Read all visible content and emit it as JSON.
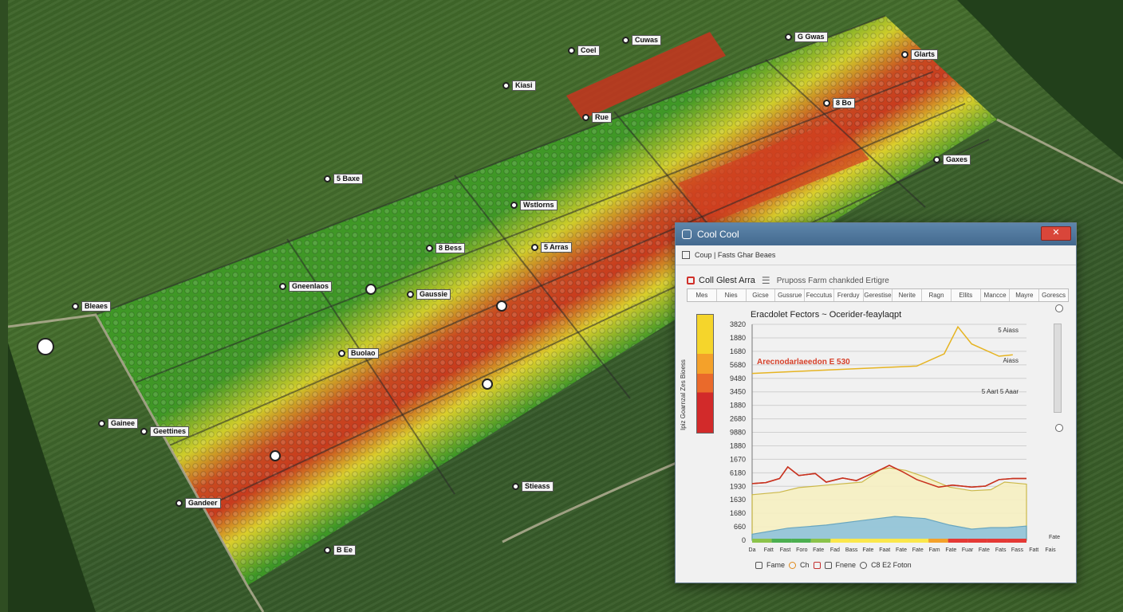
{
  "map": {
    "labels": [
      "Cuwas",
      "Coel",
      "Kiasi",
      "G Gwas",
      "Glarts",
      "Rue",
      "8 Bo",
      "Gaxes",
      "5 Baxe",
      "Wstlorns",
      "8 Bess",
      "5 Arras",
      "Gneenlaos",
      "Gaussie",
      "Buolao",
      "Bleaes",
      "Gainee",
      "Geettines",
      "Gandeer",
      "B Ee",
      "Stieass"
    ]
  },
  "window": {
    "title": "Cool Cool",
    "close_glyph": "✕",
    "menu": "Coup | Fasts Ghar Beaes",
    "section_title": "Coll Glest Arra",
    "section_menu_glyph": "☰",
    "section_subtitle": "Pruposs Farm chankded Ertigre",
    "tabs": [
      "Mes",
      "Nies",
      "Gicse",
      "Gussrue",
      "Feccutus",
      "Frerduy",
      "Gerestise",
      "Nerite",
      "Ragn",
      "Ellits",
      "Mancce",
      "Mayre",
      "Gorescs"
    ],
    "legend_label": "Ipiz Goarnzal Zes Bioess",
    "chart_title": "Eracdolet Fectors ~ Ocerider-feaylaqpt",
    "overlay_label": "Arecnodarlaeedon  E 530",
    "status": [
      "Fame",
      "Ch",
      "Fnene",
      "C8 E2 Foton"
    ]
  },
  "chart_data": [
    {
      "type": "line",
      "title": "Eracdolet Fectors ~ Ocerider-feaylaqpt",
      "y_ticks": [
        "3820",
        "1880",
        "1680",
        "5680",
        "9480",
        "3450",
        "1880",
        "2680",
        "9880",
        "1880",
        "1670",
        "6180",
        "1930",
        "1630",
        "1680",
        "660",
        "0"
      ],
      "annotations": [
        "Arecnodarlaeedon  E 530",
        "5 Aiass",
        "Aiass",
        "5 Aart 5 Aaar"
      ],
      "x_tick_labels": [
        "Da",
        "Fatt",
        "Fast",
        "Foro",
        "Fate",
        "Fad",
        "Bass",
        "Fate",
        "Faat",
        "Fate",
        "Fate",
        "Fam",
        "Fate",
        "Fuar",
        "Fate",
        "Fats",
        "Fass",
        "Fatt",
        "Fais"
      ],
      "x_end_label": "Fate",
      "x_band_colors": [
        "#8bc34a",
        "#4caf50",
        "#4caf50",
        "#8bc34a",
        "#fbe74b",
        "#fbe74b",
        "#fbe74b",
        "#fbe74b",
        "#fbe74b",
        "#f4a12a",
        "#e53935",
        "#e53935",
        "#e53935",
        "#e53935"
      ],
      "series": [
        {
          "style": "line",
          "color": "#e6b422",
          "x": [
            0,
            0.2,
            0.4,
            0.6,
            0.7,
            0.75,
            0.8,
            0.9,
            0.95
          ],
          "y": [
            2900,
            2950,
            3000,
            3050,
            3300,
            3850,
            3500,
            3250,
            3280
          ]
        },
        {
          "style": "line",
          "color": "#c8321f",
          "x": [
            0,
            0.05,
            0.1,
            0.13,
            0.17,
            0.23,
            0.27,
            0.33,
            0.38,
            0.47,
            0.5,
            0.55,
            0.6,
            0.68,
            0.73,
            0.8,
            0.85,
            0.9,
            0.95,
            1
          ],
          "y": [
            1120,
            1140,
            1220,
            1450,
            1280,
            1320,
            1150,
            1230,
            1180,
            1400,
            1480,
            1350,
            1200,
            1050,
            1090,
            1050,
            1070,
            1200,
            1220,
            1220
          ]
        },
        {
          "style": "area",
          "color": "#f7f0c2",
          "stroke": "#c9b43a",
          "x": [
            0,
            0.1,
            0.17,
            0.27,
            0.4,
            0.47,
            0.5,
            0.56,
            0.63,
            0.72,
            0.8,
            0.87,
            0.92,
            1
          ],
          "y": [
            900,
            950,
            1040,
            1090,
            1150,
            1400,
            1430,
            1380,
            1250,
            1050,
            980,
            1000,
            1150,
            1110
          ]
        },
        {
          "style": "area",
          "color": "#8fc3dc",
          "stroke": "#5a9fbf",
          "x": [
            0,
            0.13,
            0.27,
            0.4,
            0.52,
            0.63,
            0.72,
            0.8,
            0.87,
            0.93,
            1
          ],
          "y": [
            120,
            240,
            300,
            390,
            470,
            430,
            300,
            220,
            250,
            250,
            280
          ]
        }
      ]
    }
  ]
}
